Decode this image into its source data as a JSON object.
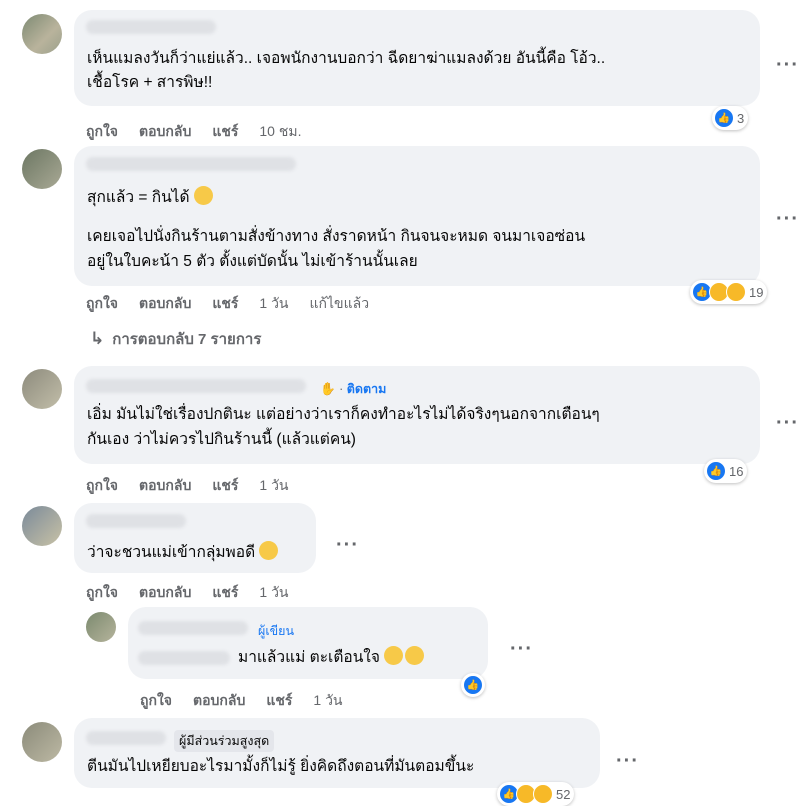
{
  "comments": [
    {
      "lines": [
        "เห็นแมลงวันก็ว่าแย่แล้ว.. เจอพนักงานบอกว่า ฉีดยาฆ่าแมลงด้วย อันนี้คือ โอ้ว..",
        "เชื้อโรค + สารพิษ!!"
      ],
      "actions": {
        "like": "ถูกใจ",
        "reply": "ตอบกลับ",
        "share": "แชร์",
        "time": "10 ชม."
      },
      "reaction_count": "3"
    },
    {
      "line1": "สุกแล้ว = กินได้",
      "lines": [
        "เคยเจอไปนั่งกินร้านตามสั่งข้างทาง สั่งราดหน้า กินจนจะหมด จนมาเจอซ่อน",
        "อยู่ในใบคะน้า 5 ตัว ตั้งแต่บัดนั้น ไม่เข้าร้านนั้นเลย"
      ],
      "actions": {
        "like": "ถูกใจ",
        "reply": "ตอบกลับ",
        "share": "แชร์",
        "time": "1 วัน",
        "edited": "แก้ไขแล้ว"
      },
      "reaction_count": "19",
      "replies_label": "การตอบกลับ 7 รายการ"
    },
    {
      "badge": "ติดตาม",
      "lines": [
        "เอิ่ม มันไม่ใช่เรื่องปกตินะ แต่อย่างว่าเราก็คงทำอะไรไม่ได้จริงๆนอกจากเตือนๆ",
        "กันเอง ว่าไม่ควรไปกินร้านนี้ (แล้วแต่คน)"
      ],
      "actions": {
        "like": "ถูกใจ",
        "reply": "ตอบกลับ",
        "share": "แชร์",
        "time": "1 วัน"
      },
      "reaction_count": "16"
    },
    {
      "text": "ว่าจะชวนแม่เข้ากลุ่มพอดี",
      "actions": {
        "like": "ถูกใจ",
        "reply": "ตอบกลับ",
        "share": "แชร์",
        "time": "1 วัน"
      }
    },
    {
      "badge": "ผู้เขียน",
      "text": "มาแล้วแม่ ตะเตือนใจ",
      "actions": {
        "like": "ถูกใจ",
        "reply": "ตอบกลับ",
        "share": "แชร์",
        "time": "1 วัน"
      }
    },
    {
      "badge": "ผู้มีส่วนร่วมสูงสุด",
      "text": "ตีนมันไปเหยียบอะไรมามั้งก็ไม่รู้ ยิ่งคิดถึงตอนที่มันตอมขึ้นะ",
      "reaction_count": "52"
    }
  ],
  "icons": {
    "like": "thumbs-up-icon",
    "more": "more-options-icon",
    "reply_arrow": "reply-arrow-icon",
    "follow_wave": "wave-hand-icon"
  },
  "colors": {
    "bubble": "#f0f2f5",
    "link": "#1877f2",
    "meta": "#65676b"
  }
}
